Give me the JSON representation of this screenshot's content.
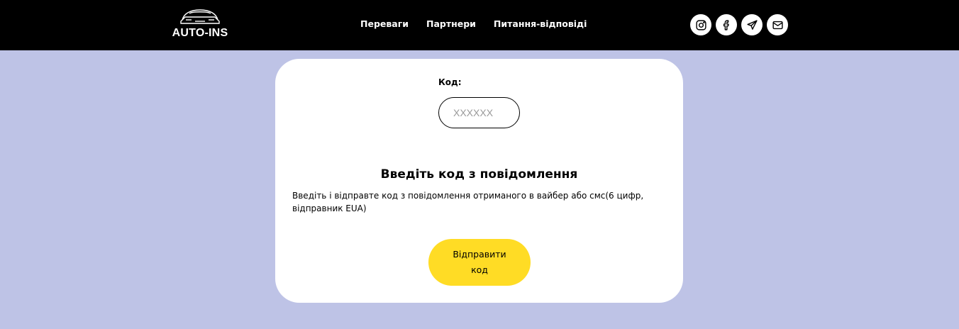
{
  "header": {
    "logo_text": "AUTO-INS",
    "nav": [
      "Переваги",
      "Партнери",
      "Питання-відповіді"
    ],
    "socials": [
      "instagram-icon",
      "facebook-icon",
      "telegram-icon",
      "mail-icon"
    ]
  },
  "form": {
    "code_label": "Код:",
    "code_placeholder": "XXXXXX",
    "code_value": "",
    "title": "Введіть код з повідомлення",
    "description": "Введіть і відправте код з повідомлення отриманого в вайбер або смс(6 цифр, відправник EUA)",
    "submit_label": "Відправити код"
  },
  "colors": {
    "background": "#bec3e6",
    "header": "#000000",
    "button": "#ffdc25",
    "card": "#ffffff"
  }
}
